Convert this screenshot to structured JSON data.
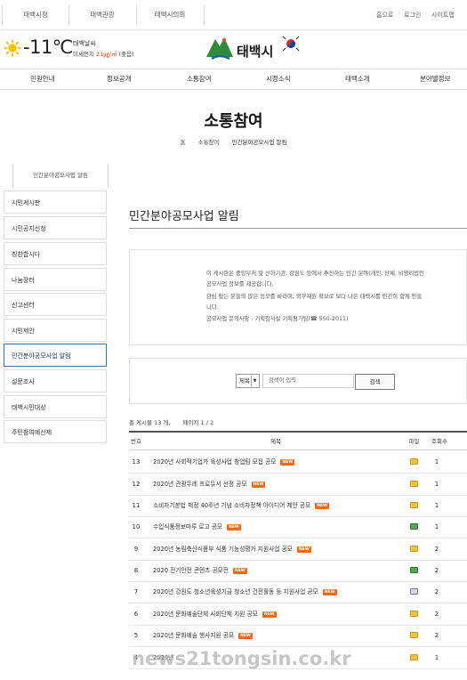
{
  "topbar": {
    "sites": [
      "태백시청",
      "태백관광",
      "태백시의회"
    ],
    "right_links": [
      "홈으로",
      "로그인",
      "사이트맵"
    ]
  },
  "weather": {
    "temperature": "-11℃",
    "label": "태백날씨",
    "dust_label": "미세먼지",
    "dust_value": "21㎍/㎥",
    "dust_grade": "(좋음)"
  },
  "logo": {
    "text": "태백시"
  },
  "nav": [
    "민원안내",
    "정보공개",
    "소통참여",
    "시정소식",
    "태백소개",
    "분야별정보"
  ],
  "page": {
    "title": "소통참여",
    "breadcrumb": [
      "홈",
      "소통참여",
      "민간분야공모사업 알림"
    ]
  },
  "sidebar": {
    "sub_tab": "민간분야공모사업 알림",
    "items": [
      "시민게시판",
      "시민공지신청",
      "칭찬합시다",
      "나눔장터",
      "신고센터",
      "시민제안",
      "민간분야공모사업 알림",
      "설문조사",
      "태백시민대상",
      "주민참여예산제"
    ],
    "active_index": 6
  },
  "content": {
    "title": "민간분야공모사업 알림",
    "notice_lines": [
      "이 게시판은 중앙부처 및 산하기관, 강원도 등에서 추진하는 민간 분야(개인, 단체, 비영리법인",
      "공모사업 정보를 제공합니다.",
      "관심 있는 분들의 많은 응모를 바라며, 외부재원 확보로 보다 나은 태백시를 민간이 함께 만들",
      "니다.",
      "공모사업 문의사항 : 기획감사실 기획평가팀(☎ 550-2011)"
    ]
  },
  "search": {
    "field_option": "제목",
    "placeholder": "검색어 입력",
    "button": "검색"
  },
  "summary": {
    "total": "총 게시물 13 개,",
    "page": "페이지 1 / 2"
  },
  "table": {
    "headers": [
      "번호",
      "제목",
      "파일",
      "조회수"
    ],
    "rows": [
      {
        "no": "13",
        "title": "2020년 사회적기업가 육성사업 창업팀 모집 공모",
        "badge": "NEW",
        "file": "folder",
        "views": "1"
      },
      {
        "no": "12",
        "title": "2020년 관광두레 프로듀서 선정 공모",
        "badge": "NEW",
        "file": "folder",
        "views": "1"
      },
      {
        "no": "11",
        "title": "소비자기본법 제정 40주년 기념 소비자정책 아이디어 제안 공모",
        "badge": "NEW",
        "file": "folder",
        "views": "1"
      },
      {
        "no": "10",
        "title": "수입식품정보마루 로고 공모",
        "badge": "NEW",
        "file": "hwp",
        "views": "1"
      },
      {
        "no": "9",
        "title": "2020년 농림축산식품부 식품 기능성평가 지원사업 공모",
        "badge": "NEW",
        "file": "folder",
        "views": "2"
      },
      {
        "no": "8",
        "title": "2020 전기안전 콘텐츠 공모전",
        "badge": "NEW",
        "file": "hwp",
        "views": "2"
      },
      {
        "no": "7",
        "title": "2020년 강원도 청소년육성기금 청소년 건전활동 등 지원사업 공모",
        "badge": "NEW",
        "file": "img",
        "views": "2"
      },
      {
        "no": "6",
        "title": "2020년 문화예술단체 사회단체 지원 공모",
        "badge": "NEW",
        "file": "folder",
        "views": "2"
      },
      {
        "no": "5",
        "title": "2020년 문화예술 행사지원 공모",
        "badge": "NEW",
        "file": "folder",
        "views": "2"
      },
      {
        "no": "4",
        "title": "2020년 ...",
        "badge": "",
        "file": "folder",
        "views": "1"
      }
    ]
  },
  "watermark": "news21tongsin.co.kr",
  "colors": {
    "accent": "#3a6fb3",
    "new_badge": "#f06a1a",
    "logo_green": "#2e8b3a"
  }
}
